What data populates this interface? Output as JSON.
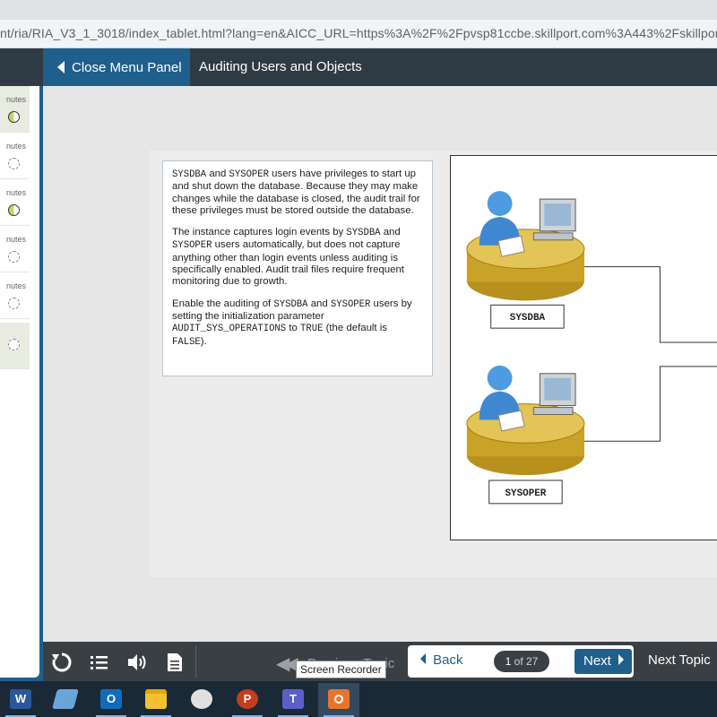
{
  "browser": {
    "url": "nt/ria/RIA_V3_1_3018/index_tablet.html?lang=en&AICC_URL=https%3A%2F%2Fpvsp81ccbe.skillport.com%3A443%2Fskillport"
  },
  "header": {
    "close_menu_label": "Close Menu Panel",
    "course_title": "Auditing Users and Objects"
  },
  "menu_panel": {
    "items": [
      {
        "label": "nutes",
        "status": "half"
      },
      {
        "label": "nutes",
        "status": "not-started"
      },
      {
        "label": "nutes",
        "status": "half"
      },
      {
        "label": "nutes",
        "status": "not-started"
      },
      {
        "label": "nutes",
        "status": "not-started"
      },
      {
        "label": "",
        "status": "not-started"
      }
    ]
  },
  "content": {
    "paragraphs": [
      [
        {
          "t": "SYSDBA",
          "mono": true
        },
        {
          "t": " and ",
          "mono": false
        },
        {
          "t": "SYSOPER",
          "mono": true
        },
        {
          "t": " users have privileges to start up and shut down the database. Because they may make changes while the database is closed, the audit trail for these privileges must be stored outside the database.",
          "mono": false
        }
      ],
      [
        {
          "t": "The instance captures login events by ",
          "mono": false
        },
        {
          "t": "SYSDBA",
          "mono": true
        },
        {
          "t": " and ",
          "mono": false
        },
        {
          "t": "SYSOPER",
          "mono": true
        },
        {
          "t": " users automatically, but does not capture anything other than login events unless auditing is specifically enabled. Audit trail files require frequent monitoring due to growth.",
          "mono": false
        }
      ],
      [
        {
          "t": "Enable the auditing of ",
          "mono": false
        },
        {
          "t": "SYSDBA",
          "mono": true
        },
        {
          "t": " and ",
          "mono": false
        },
        {
          "t": "SYSOPER",
          "mono": true
        },
        {
          "t": " users by setting the initialization parameter ",
          "mono": false
        },
        {
          "t": "AUDIT_SYS_OPERATIONS",
          "mono": true
        },
        {
          "t": " to ",
          "mono": false
        },
        {
          "t": "TRUE",
          "mono": true
        },
        {
          "t": " (the default is ",
          "mono": false
        },
        {
          "t": "FALSE",
          "mono": true
        },
        {
          "t": ").",
          "mono": false
        }
      ]
    ],
    "diagram": {
      "user1_label": "SYSDBA",
      "user2_label": "SYSOPER"
    }
  },
  "nav": {
    "prev_topic_label": "Previous Topic",
    "back_label": "Back",
    "page_current": "1",
    "page_of": "of 27",
    "next_label": "Next",
    "next_topic_label": "Next Topic",
    "tooltip": "Screen Recorder"
  },
  "taskbar": {
    "apps": [
      {
        "name": "word",
        "glyph": "W",
        "color": "#2b579a"
      },
      {
        "name": "notes",
        "glyph": "",
        "color": "#6aa5d9"
      },
      {
        "name": "outlook",
        "glyph": "O",
        "color": "#0f6cbd"
      },
      {
        "name": "file-explorer",
        "glyph": "",
        "color": "#f2c230"
      },
      {
        "name": "paint",
        "glyph": "",
        "color": "#e0e0e0"
      },
      {
        "name": "powerpoint",
        "glyph": "P",
        "color": "#c43e1c"
      },
      {
        "name": "teams",
        "glyph": "T",
        "color": "#5b5fc7"
      },
      {
        "name": "screen-recorder",
        "glyph": "",
        "color": "#e8742c"
      }
    ]
  },
  "colors": {
    "accent": "#1f5f8b",
    "nav_bg": "#3a3f44",
    "page_bg": "#e6e6e6"
  }
}
